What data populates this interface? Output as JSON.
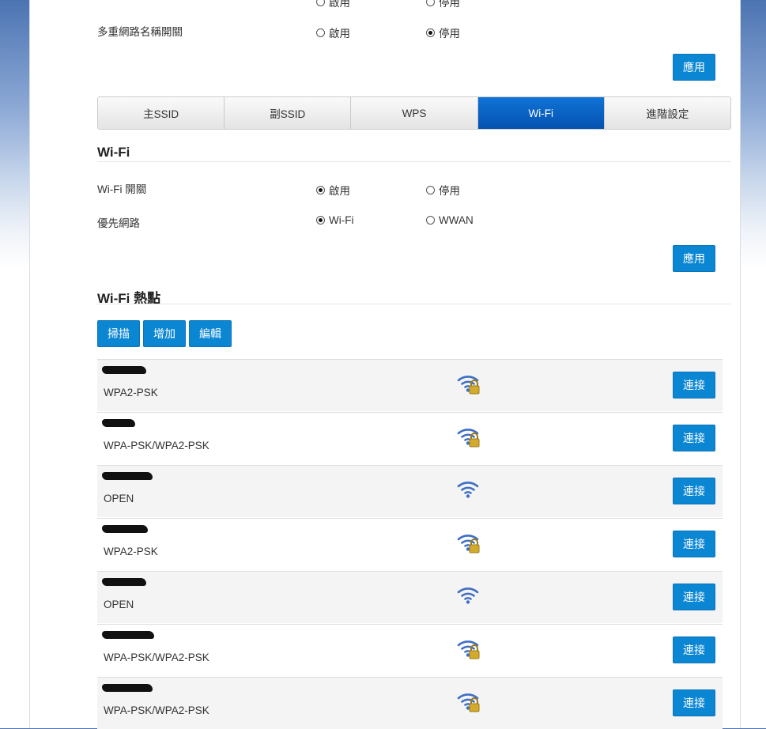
{
  "multi_ssid": {
    "label": "多重網路名稱開關",
    "top_cut": "啟用",
    "top_cut2": "停用",
    "options": [
      "啟用",
      "停用"
    ],
    "selected": "停用"
  },
  "apply_label": "應用",
  "tabs": [
    {
      "label": "主SSID",
      "active": false
    },
    {
      "label": "副SSID",
      "active": false
    },
    {
      "label": "WPS",
      "active": false
    },
    {
      "label": "Wi-Fi",
      "active": true
    },
    {
      "label": "進階設定",
      "active": false
    }
  ],
  "wifi_section": {
    "title": "Wi-Fi",
    "switch": {
      "label": "Wi-Fi 開關",
      "options": [
        "啟用",
        "停用"
      ],
      "selected": "啟用"
    },
    "priority": {
      "label": "優先網路",
      "options": [
        "Wi-Fi",
        "WWAN"
      ],
      "selected": "Wi-Fi"
    }
  },
  "hotspot": {
    "title": "Wi-Fi 熱點",
    "buttons": {
      "scan": "掃描",
      "add": "增加",
      "edit": "編輯"
    },
    "connect_label": "連接",
    "items": [
      {
        "security": "WPA2-PSK",
        "locked": true
      },
      {
        "security": "WPA-PSK/WPA2-PSK",
        "locked": true
      },
      {
        "security": "OPEN",
        "locked": false
      },
      {
        "security": "WPA2-PSK",
        "locked": true
      },
      {
        "security": "OPEN",
        "locked": false
      },
      {
        "security": "WPA-PSK/WPA2-PSK",
        "locked": true
      },
      {
        "security": "WPA-PSK/WPA2-PSK",
        "locked": true
      }
    ]
  },
  "colors": {
    "primary": "#0b86d3",
    "tab_active": "#0452b0",
    "wifi_icon": "#3f6fc4",
    "lock": "#d4aa2a"
  }
}
